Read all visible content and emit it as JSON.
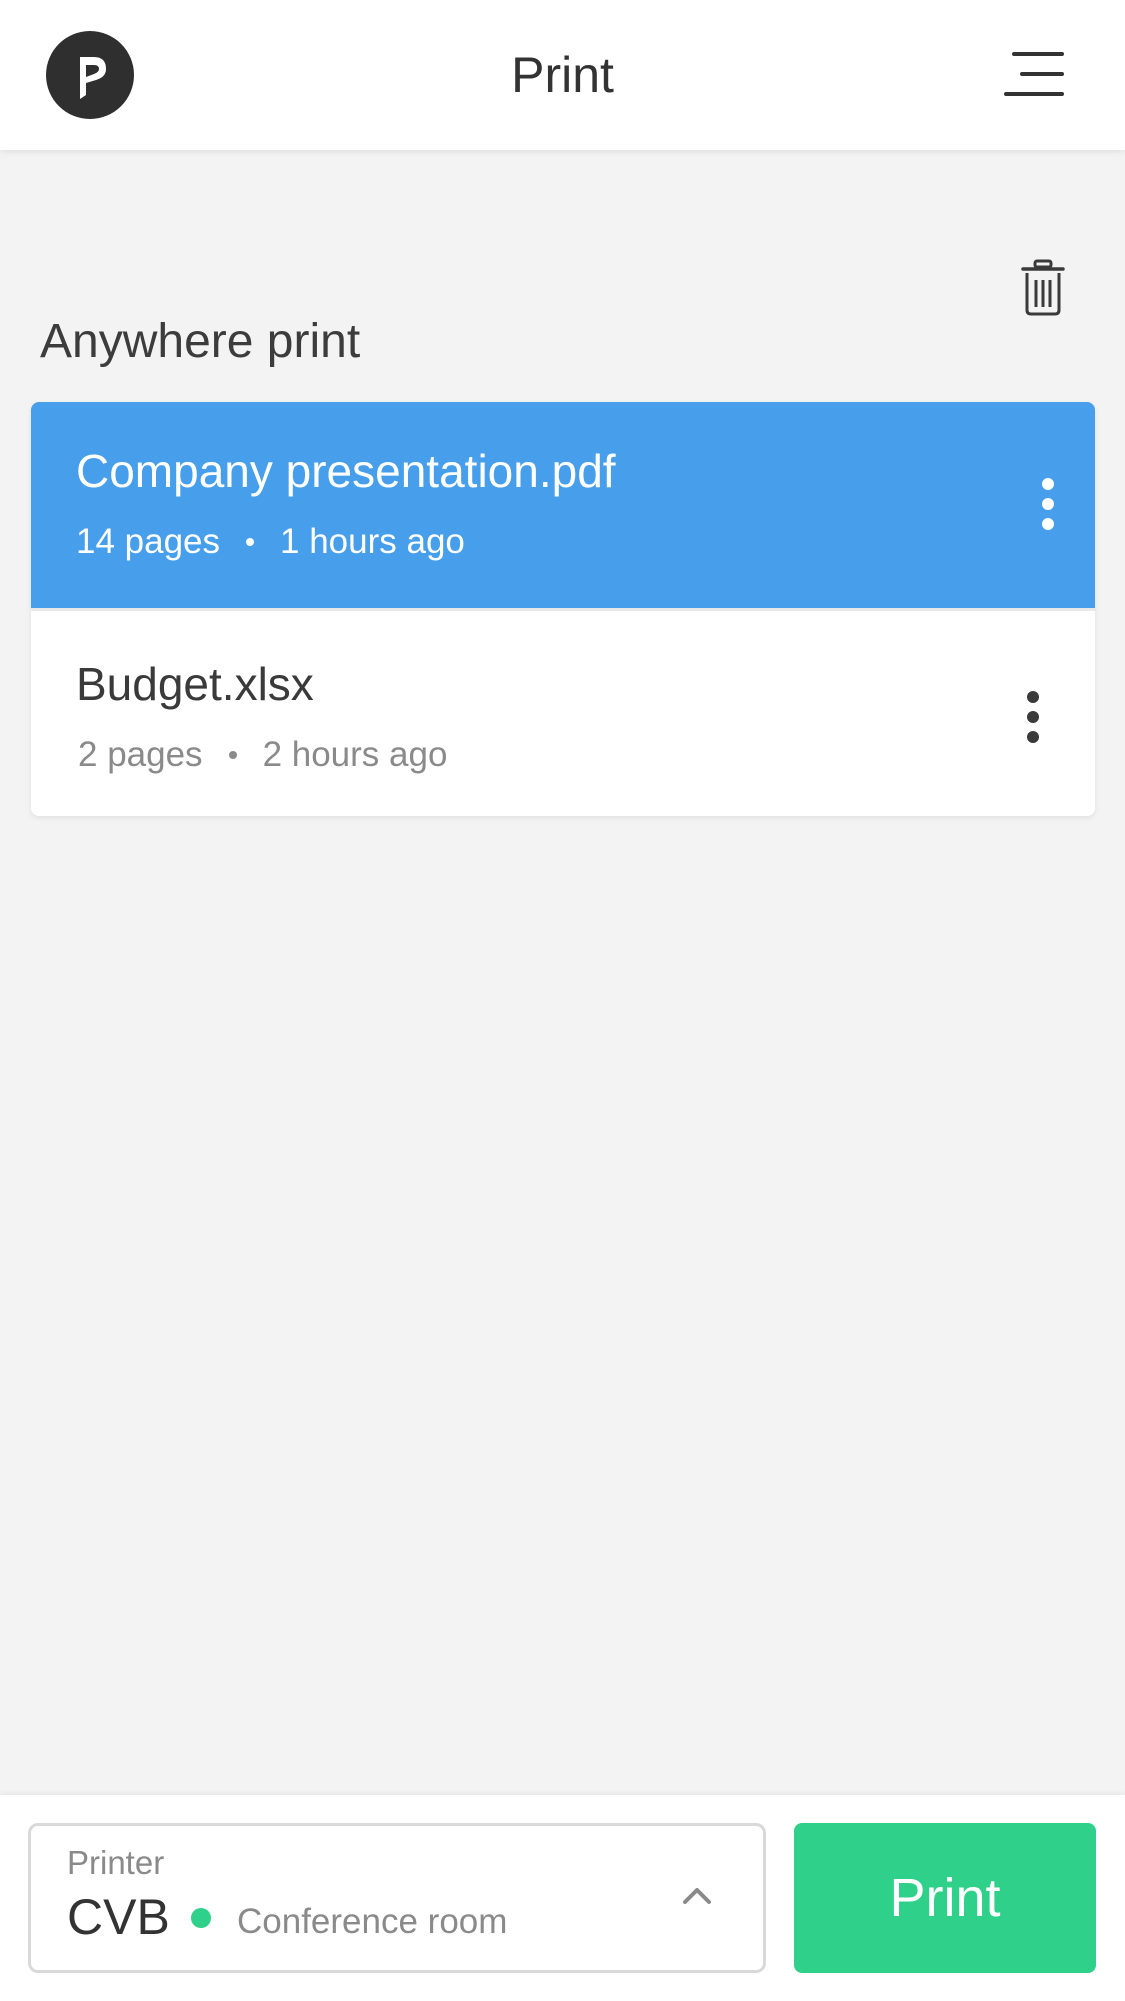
{
  "header": {
    "title": "Print",
    "logo_icon": "logo-icon",
    "menu_icon": "hamburger-menu-icon"
  },
  "section": {
    "title": "Anywhere print",
    "delete_icon": "trash-icon"
  },
  "jobs": [
    {
      "name": "Company presentation.pdf",
      "pages": "14 pages",
      "time": "1 hours ago",
      "selected": true
    },
    {
      "name": "Budget.xlsx",
      "pages": "2 pages",
      "time": "2 hours ago",
      "selected": false
    }
  ],
  "printer": {
    "label": "Printer",
    "name": "CVB",
    "location": "Conference room",
    "status": "online",
    "chevron_icon": "chevron-up-icon"
  },
  "print_button": {
    "label": "Print"
  },
  "colors": {
    "selected_row": "#479eea",
    "accent_green": "#2fd18a",
    "status_online": "#2fd18a",
    "background": "#f3f3f3"
  }
}
